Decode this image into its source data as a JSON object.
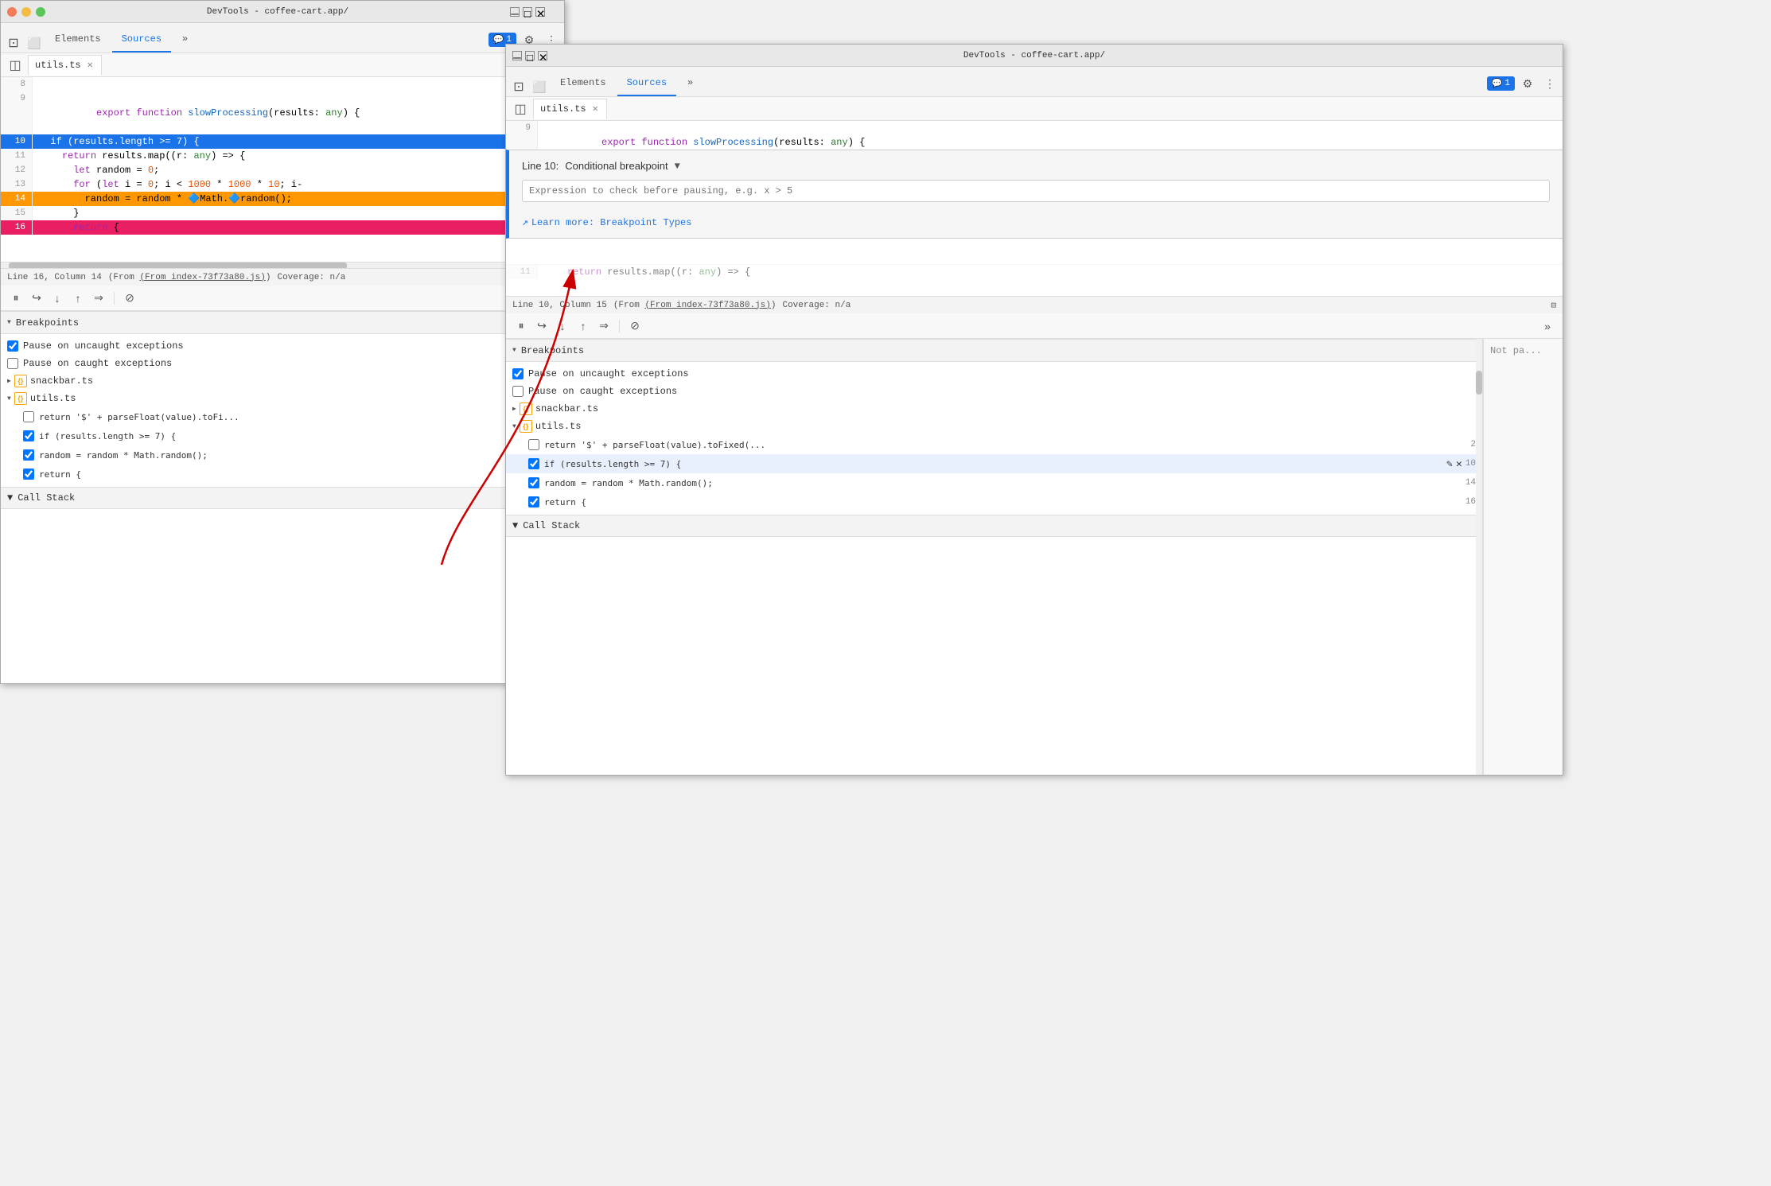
{
  "window1": {
    "title": "DevTools - coffee-cart.app/",
    "tabs": [
      {
        "label": "Elements",
        "active": false
      },
      {
        "label": "Sources",
        "active": true
      },
      {
        "label": "more",
        "active": false
      }
    ],
    "msgBadge": "1",
    "fileTab": "utils.ts",
    "statusBar": {
      "line": "Line 16, Column 14",
      "source": "(From index-73f73a80.js)",
      "coverage": "Coverage: n/a"
    },
    "code": {
      "lines": [
        {
          "num": "8",
          "content": ""
        },
        {
          "num": "9",
          "content": "export function slowProcessing(results: any) {",
          "type": "normal"
        },
        {
          "num": "10",
          "content": "  if (results.length >= 7) {",
          "type": "breakpoint-active"
        },
        {
          "num": "11",
          "content": "    return results.map((r: any) => {",
          "type": "normal"
        },
        {
          "num": "12",
          "content": "      let random = 0;",
          "type": "normal"
        },
        {
          "num": "13",
          "content": "      for (let i = 0; i < 1000 * 1000 * 10; i-",
          "type": "normal"
        },
        {
          "num": "14",
          "content": "        random = random * Math.random();",
          "type": "breakpoint-warning"
        },
        {
          "num": "15",
          "content": "      }",
          "type": "normal"
        },
        {
          "num": "16",
          "content": "      return {",
          "type": "breakpoint-pink"
        }
      ]
    },
    "breakpoints": {
      "sectionLabel": "Breakpoints",
      "pauseUncaught": "Pause on uncaught exceptions",
      "pauseCaught": "Pause on caught exceptions",
      "files": [
        {
          "name": "snackbar.ts",
          "expanded": false,
          "items": []
        },
        {
          "name": "utils.ts",
          "expanded": true,
          "items": [
            {
              "code": "return '$' + parseFloat(value).toFi...",
              "line": "2",
              "checked": false,
              "editing": true
            },
            {
              "code": "if (results.length >= 7) {",
              "line": "10",
              "checked": true,
              "editing": false
            },
            {
              "code": "random = random * Math.random();",
              "line": "14",
              "checked": true,
              "editing": false
            },
            {
              "code": "return {",
              "line": "16",
              "checked": true,
              "editing": false
            }
          ]
        }
      ]
    },
    "callStack": {
      "label": "Call Stack"
    }
  },
  "window2": {
    "title": "DevTools - coffee-cart.app/",
    "tabs": [
      {
        "label": "Elements",
        "active": false
      },
      {
        "label": "Sources",
        "active": true
      },
      {
        "label": "more",
        "active": false
      }
    ],
    "msgBadge": "1",
    "fileTab": "utils.ts",
    "statusBar": {
      "line": "Line 10, Column 15",
      "source": "(From index-73f73a80.js)",
      "coverage": "Coverage: n/a"
    },
    "code": {
      "lines": [
        {
          "num": "9",
          "content": "export function slowProcessing(results: any) {",
          "type": "normal"
        },
        {
          "num": "10",
          "content": "  if (results.length >= 7) {",
          "type": "breakpoint-active"
        }
      ]
    },
    "bpPopup": {
      "lineLabel": "Line 10:",
      "title": "Conditional breakpoint",
      "placeholder": "Expression to check before pausing, e.g. x > 5",
      "linkText": "Learn more: Breakpoint Types",
      "linkUrl": "#"
    },
    "breakpoints": {
      "sectionLabel": "Breakpoints",
      "pauseUncaught": "Pause on uncaught exceptions",
      "pauseCaught": "Pause on caught exceptions",
      "files": [
        {
          "name": "snackbar.ts",
          "expanded": false,
          "items": []
        },
        {
          "name": "utils.ts",
          "expanded": true,
          "items": [
            {
              "code": "return '$' + parseFloat(value).toFixed(...",
              "line": "2",
              "checked": false,
              "editing": false
            },
            {
              "code": "if (results.length >= 7) {",
              "line": "10",
              "checked": true,
              "editing": true
            },
            {
              "code": "random = random * Math.random();",
              "line": "14",
              "checked": true,
              "editing": false
            },
            {
              "code": "return {",
              "line": "16",
              "checked": true,
              "editing": false
            }
          ]
        }
      ]
    },
    "callStack": {
      "label": "Call Stack"
    },
    "notPa": "Not pa..."
  },
  "icons": {
    "elements": "⬜",
    "inspect": "⊡",
    "device": "📱",
    "more": "»",
    "gear": "⚙",
    "dots": "⋮",
    "sidebar": "◫",
    "pause": "⏸",
    "stepOver": "↪",
    "stepInto": "↓",
    "stepOut": "↑",
    "continue": "→",
    "deactivate": "⊘",
    "expand": "▶",
    "collapse": "▼",
    "triangle_right": "▶",
    "triangle_down": "▼",
    "external": "↗",
    "edit": "✎",
    "delete": "✕",
    "checkbox_checked": "✓",
    "checkbox_unchecked": " "
  }
}
